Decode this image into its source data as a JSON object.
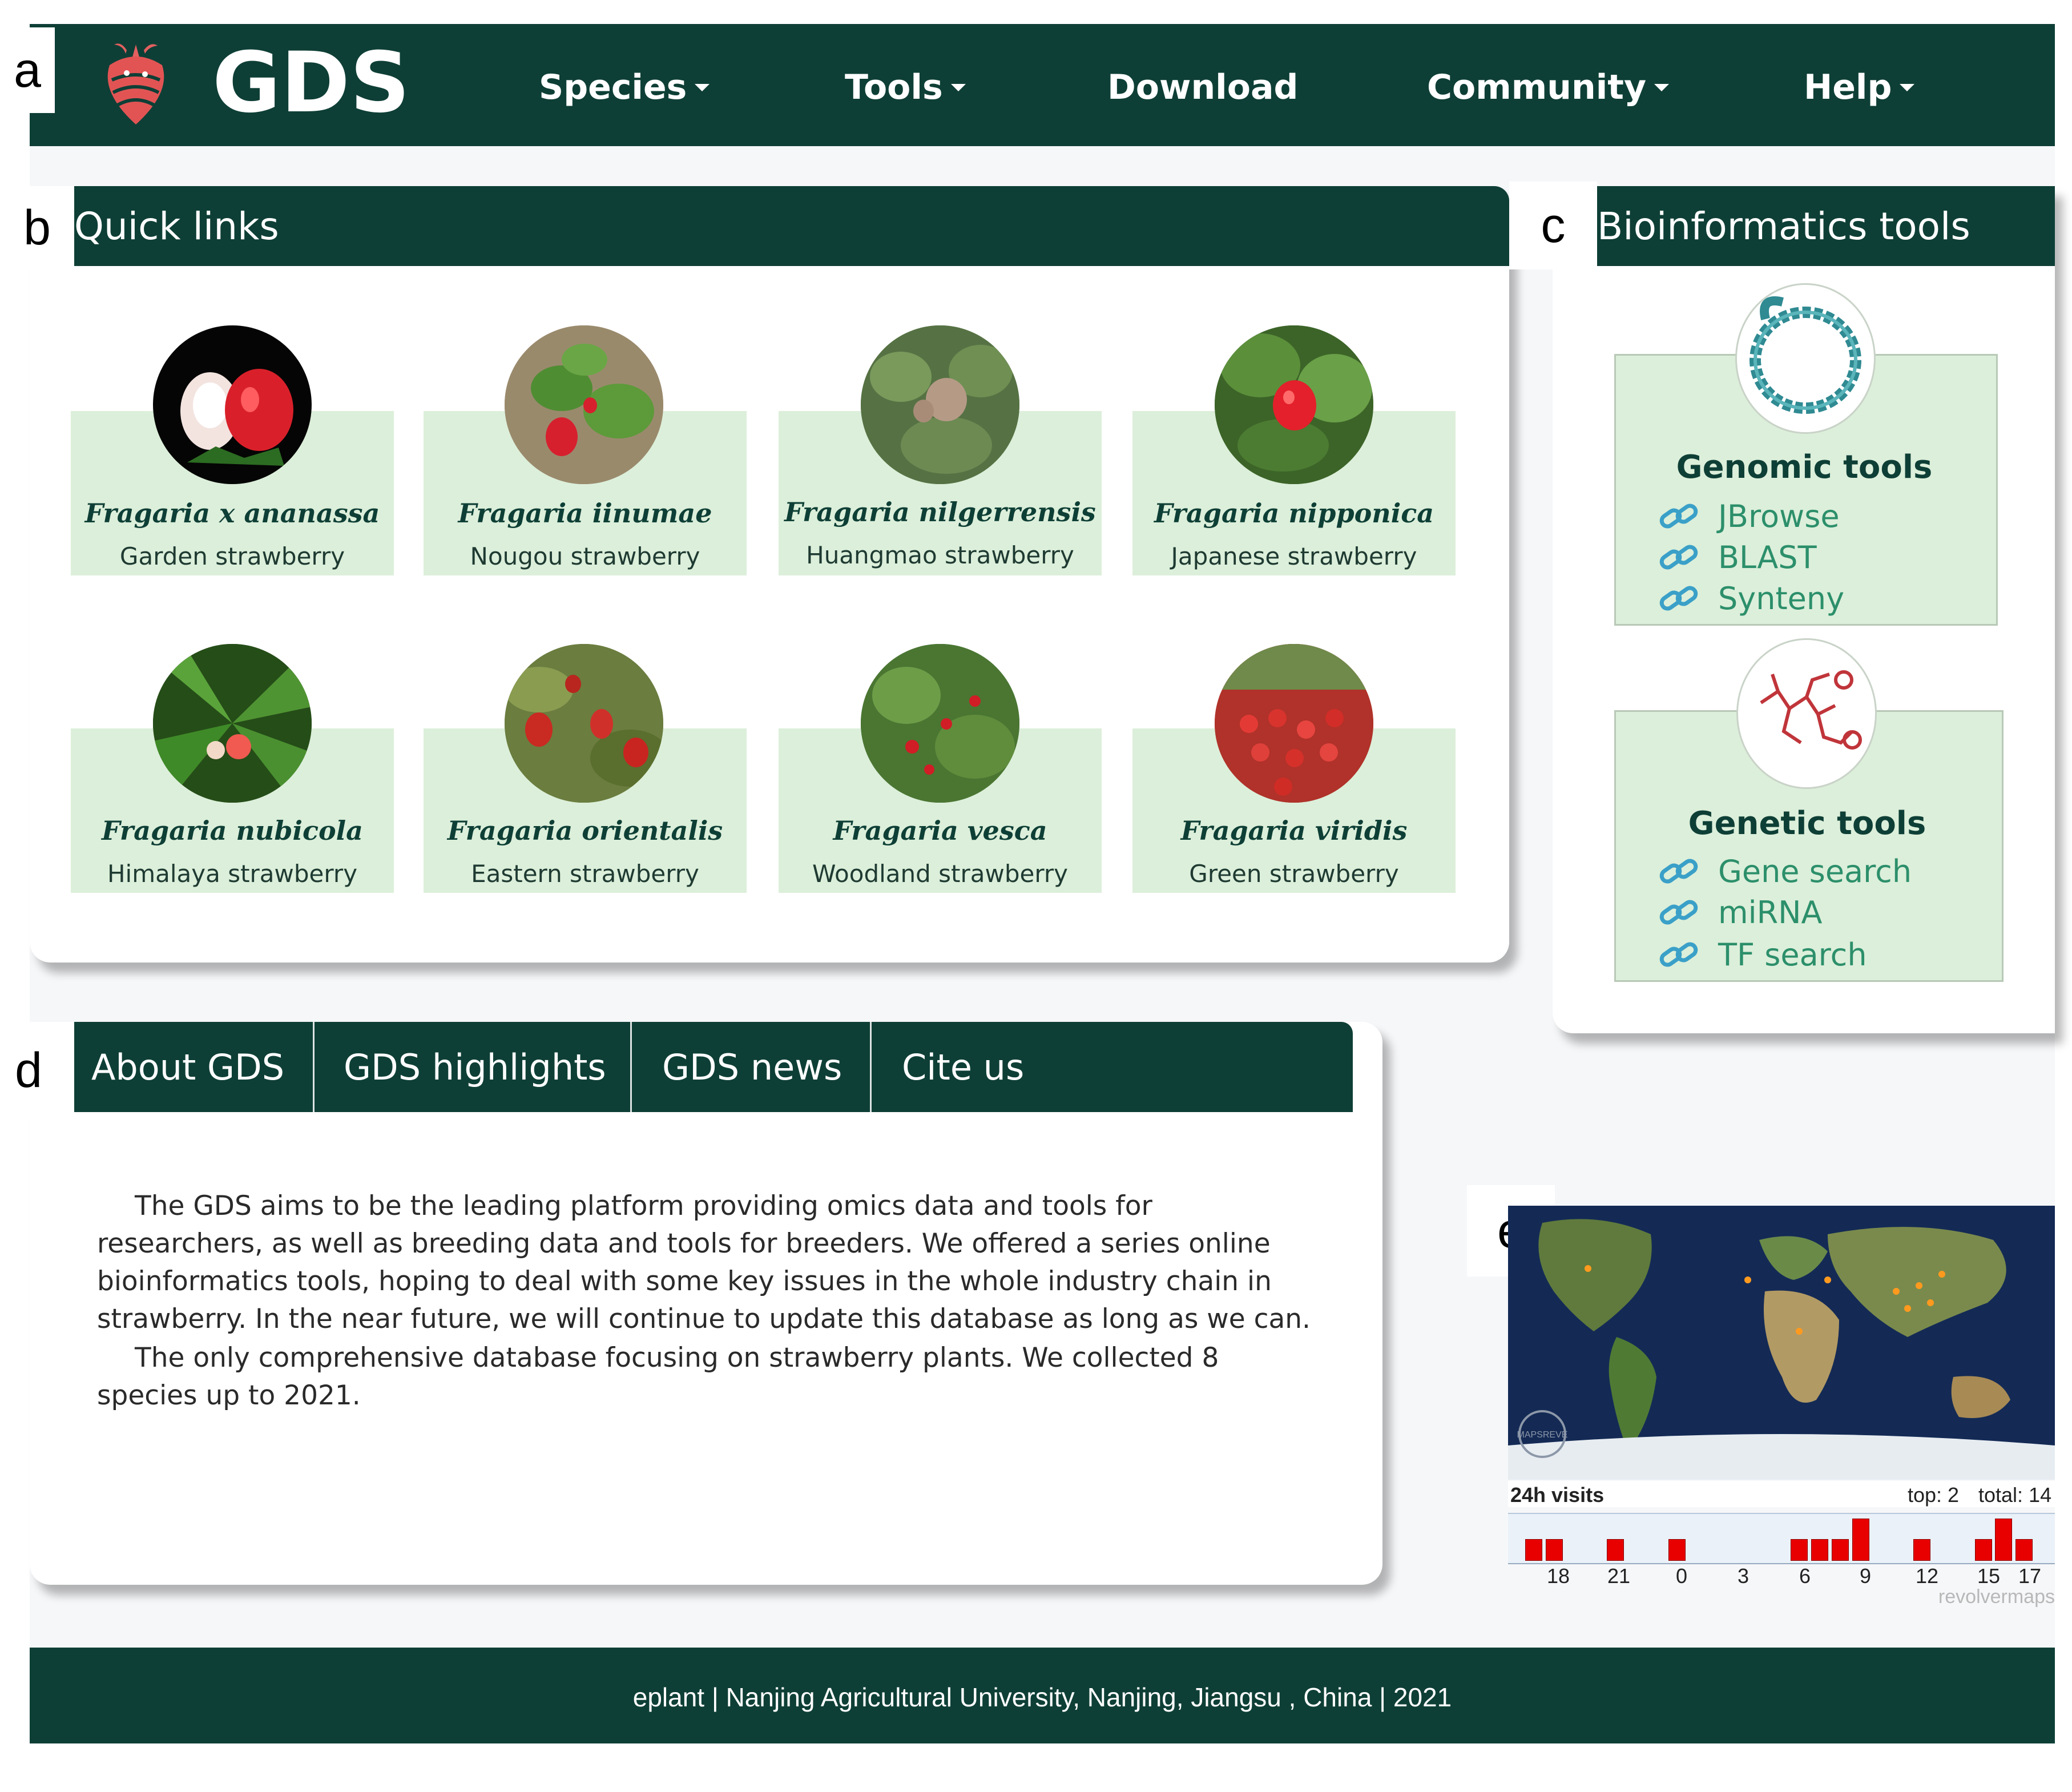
{
  "panel_letters": {
    "a": "a",
    "b": "b",
    "c": "c",
    "d": "d",
    "e": "e"
  },
  "navbar": {
    "brand": "GDS",
    "items": [
      {
        "label": "Species",
        "has_dropdown": true
      },
      {
        "label": "Tools",
        "has_dropdown": true
      },
      {
        "label": "Download",
        "has_dropdown": false
      },
      {
        "label": "Community",
        "has_dropdown": true
      },
      {
        "label": "Help",
        "has_dropdown": true
      }
    ]
  },
  "quick_links": {
    "title": "Quick links",
    "species": [
      {
        "scientific": "Fragaria x ananassa",
        "common": "Garden strawberry"
      },
      {
        "scientific": "Fragaria iinumae",
        "common": "Nougou strawberry"
      },
      {
        "scientific": "Fragaria nilgerrensis",
        "common": "Huangmao strawberry"
      },
      {
        "scientific": "Fragaria nipponica",
        "common": "Japanese strawberry"
      },
      {
        "scientific": "Fragaria nubicola",
        "common": "Himalaya strawberry"
      },
      {
        "scientific": "Fragaria orientalis",
        "common": "Eastern strawberry"
      },
      {
        "scientific": "Fragaria vesca",
        "common": "Woodland strawberry"
      },
      {
        "scientific": "Fragaria viridis",
        "common": "Green strawberry"
      }
    ]
  },
  "bioinformatics": {
    "title": "Bioinformatics tools",
    "genomic": {
      "title": "Genomic tools",
      "links": [
        "JBrowse",
        "BLAST",
        "Synteny"
      ]
    },
    "genetic": {
      "title": "Genetic tools",
      "links": [
        "Gene search",
        "miRNA",
        "TF search"
      ]
    }
  },
  "about": {
    "tabs": [
      "About GDS",
      "GDS highlights",
      "GDS news",
      "Cite us"
    ],
    "paragraphs": [
      "The GDS aims to be the leading platform providing omics data and tools for researchers, as well as breeding data and tools for breeders. We offered a series online bioinformatics tools, hoping to deal with some key issues in the whole industry chain in strawberry. In the near future, we will continue to update this database as long as we can.",
      "The only comprehensive database focusing on strawberry plants. We collected 8 species up to 2021."
    ]
  },
  "visitor_map": {
    "visits_label": "24h visits",
    "top_label": "top: 2",
    "total_label": "total: 14",
    "hour_labels": [
      "18",
      "21",
      "0",
      "3",
      "6",
      "9",
      "12",
      "15",
      "17"
    ],
    "brand": "revolvermaps",
    "stamp": "MAPSREVE",
    "bar_colors": {
      "bar": "#e80000"
    }
  },
  "chart_data": {
    "type": "bar",
    "title": "24h visits",
    "xlabel": "",
    "ylabel": "",
    "categories": [
      "17",
      "18",
      "19",
      "20",
      "21",
      "22",
      "23",
      "0",
      "1",
      "2",
      "3",
      "4",
      "5",
      "6",
      "7",
      "8",
      "9",
      "10",
      "11",
      "12",
      "13",
      "14",
      "15",
      "16",
      "17"
    ],
    "values": [
      1,
      1,
      0,
      0,
      1,
      0,
      0,
      1,
      0,
      0,
      0,
      0,
      0,
      1,
      1,
      1,
      2,
      0,
      0,
      1,
      0,
      0,
      1,
      2,
      1
    ],
    "ylim": [
      0,
      2
    ],
    "top": 2,
    "total": 14
  },
  "footer": {
    "text": "eplant | Nanjing Agricultural University, Nanjing, Jiangsu , China | 2021"
  },
  "colors": {
    "brand_green": "#0e3f36",
    "tile_green": "#dcefda",
    "link_teal": "#2c8f6b"
  }
}
